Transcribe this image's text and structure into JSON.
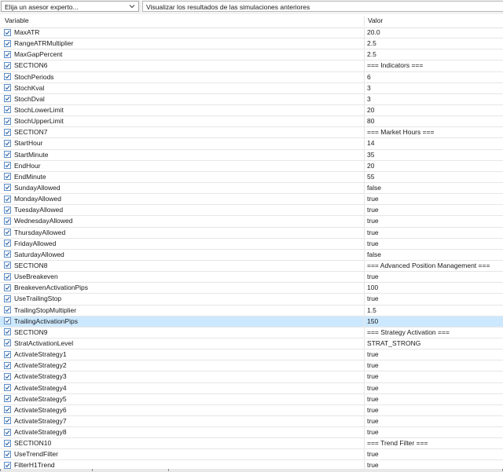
{
  "toolbar": {
    "expert_select": "Elija un asesor experto...",
    "previous_results_button": "Visualizar los resultados de las simulaciones anteriores"
  },
  "table": {
    "columns": {
      "variable": "Variable",
      "value": "Valor"
    },
    "selected_row": "TrailingActivationPips",
    "rows": [
      {
        "name": "MaxATR",
        "value": "20.0",
        "checked": true
      },
      {
        "name": "RangeATRMultiplier",
        "value": "2.5",
        "checked": true
      },
      {
        "name": "MaxGapPercent",
        "value": "2.5",
        "checked": true
      },
      {
        "name": "SECTION6",
        "value": "=== Indicators ===",
        "checked": true
      },
      {
        "name": "StochPeriods",
        "value": "6",
        "checked": true
      },
      {
        "name": "StochKval",
        "value": "3",
        "checked": true
      },
      {
        "name": "StochDval",
        "value": "3",
        "checked": true
      },
      {
        "name": "StochLowerLimit",
        "value": "20",
        "checked": true
      },
      {
        "name": "StochUpperLimit",
        "value": "80",
        "checked": true
      },
      {
        "name": "SECTION7",
        "value": "=== Market Hours ===",
        "checked": true
      },
      {
        "name": "StartHour",
        "value": "14",
        "checked": true
      },
      {
        "name": "StartMinute",
        "value": "35",
        "checked": true
      },
      {
        "name": "EndHour",
        "value": "20",
        "checked": true
      },
      {
        "name": "EndMinute",
        "value": "55",
        "checked": true
      },
      {
        "name": "SundayAllowed",
        "value": "false",
        "checked": true
      },
      {
        "name": "MondayAllowed",
        "value": "true",
        "checked": true
      },
      {
        "name": "TuesdayAllowed",
        "value": "true",
        "checked": true
      },
      {
        "name": "WednesdayAllowed",
        "value": "true",
        "checked": true
      },
      {
        "name": "ThursdayAllowed",
        "value": "true",
        "checked": true
      },
      {
        "name": "FridayAllowed",
        "value": "true",
        "checked": true
      },
      {
        "name": "SaturdayAllowed",
        "value": "false",
        "checked": true
      },
      {
        "name": "SECTION8",
        "value": "=== Advanced Position Management ===",
        "checked": true
      },
      {
        "name": "UseBreakeven",
        "value": "true",
        "checked": true
      },
      {
        "name": "BreakevenActivationPips",
        "value": "100",
        "checked": true
      },
      {
        "name": "UseTrailingStop",
        "value": "true",
        "checked": true
      },
      {
        "name": "TrailingStopMultiplier",
        "value": "1.5",
        "checked": true
      },
      {
        "name": "TrailingActivationPips",
        "value": "150",
        "checked": true
      },
      {
        "name": "SECTION9",
        "value": "=== Strategy Activation ===",
        "checked": true
      },
      {
        "name": "StratActivationLevel",
        "value": "STRAT_STRONG",
        "checked": true
      },
      {
        "name": "ActivateStrategy1",
        "value": "true",
        "checked": true
      },
      {
        "name": "ActivateStrategy2",
        "value": "true",
        "checked": true
      },
      {
        "name": "ActivateStrategy3",
        "value": "true",
        "checked": true
      },
      {
        "name": "ActivateStrategy4",
        "value": "true",
        "checked": true
      },
      {
        "name": "ActivateStrategy5",
        "value": "true",
        "checked": true
      },
      {
        "name": "ActivateStrategy6",
        "value": "true",
        "checked": true
      },
      {
        "name": "ActivateStrategy7",
        "value": "true",
        "checked": true
      },
      {
        "name": "ActivateStrategy8",
        "value": "true",
        "checked": true
      },
      {
        "name": "SECTION10",
        "value": "=== Trend Filter ===",
        "checked": true
      },
      {
        "name": "UseTrendFilter",
        "value": "true",
        "checked": true
      },
      {
        "name": "FilterH1Trend",
        "value": "true",
        "checked": true
      }
    ]
  },
  "colors": {
    "selection": "#cce8ff",
    "checkbox_border": "#5d8fc8",
    "checkmark": "#2b5fa3"
  },
  "icons": {
    "dropdown": "chevron-down-icon",
    "checkbox": "checkmark-icon"
  }
}
